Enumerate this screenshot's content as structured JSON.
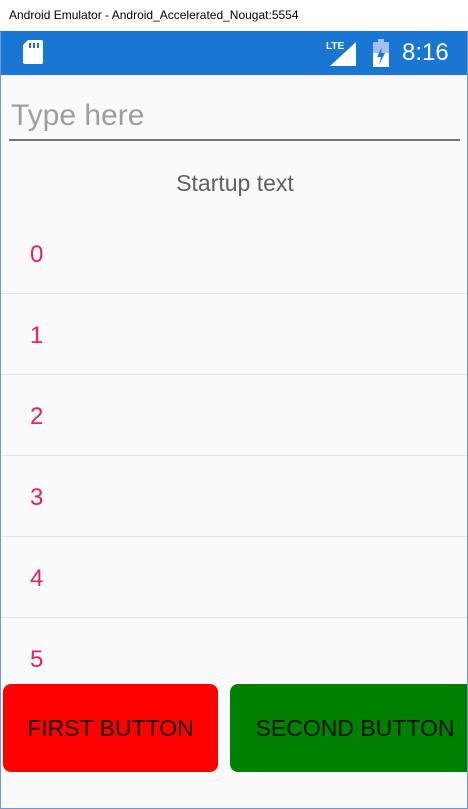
{
  "window": {
    "title": "Android Emulator - Android_Accelerated_Nougat:5554"
  },
  "status_bar": {
    "time": "8:16",
    "network_label": "LTE",
    "icons": [
      "sd-card-icon",
      "lte-signal-icon",
      "battery-icon"
    ]
  },
  "entry": {
    "placeholder": "Type here",
    "value": ""
  },
  "label": {
    "text": "Startup text"
  },
  "list": {
    "items": [
      "0",
      "1",
      "2",
      "3",
      "4",
      "5"
    ]
  },
  "buttons": {
    "first": "FIRST BUTTON",
    "second": "SECOND BUTTON"
  },
  "colors": {
    "status_bar": "#1976d2",
    "list_item_text": "#e91e63",
    "first_button": "#ff0000",
    "second_button": "#008000"
  }
}
